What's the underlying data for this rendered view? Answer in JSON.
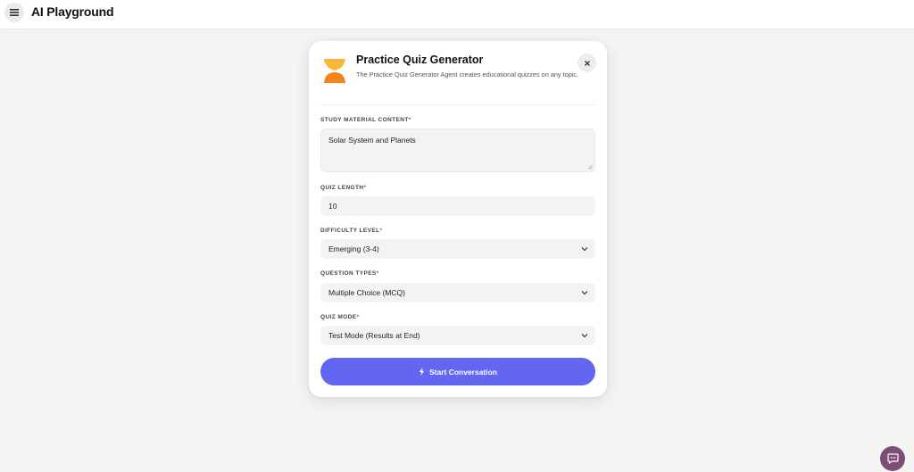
{
  "app": {
    "title": "AI Playground",
    "menu_icon": "hamburger-menu-icon"
  },
  "modal": {
    "title": "Practice Quiz Generator",
    "description": "The Practice Quiz Generator Agent creates educational quizzes on any topic.",
    "logo_icon": "quiz-generator-logo-icon",
    "close_icon": "close-icon",
    "fields": {
      "study_material": {
        "label": "STUDY MATERIAL CONTENT",
        "required_mark": "*",
        "value": "Solar System and Planets"
      },
      "quiz_length": {
        "label": "QUIZ LENGTH",
        "required_mark": "*",
        "value": "10"
      },
      "difficulty": {
        "label": "DIFFICULTY LEVEL",
        "required_mark": "*",
        "value": "Emerging (3-4)"
      },
      "question_types": {
        "label": "QUESTION TYPES",
        "required_mark": "*",
        "value": "Multiple Choice (MCQ)"
      },
      "quiz_mode": {
        "label": "QUIZ MODE",
        "required_mark": "*",
        "value": "Test Mode (Results at End)"
      }
    },
    "start_button": {
      "label": "Start Conversation",
      "icon": "lightning-bolt-icon"
    }
  },
  "chat_fab": {
    "icon": "chat-bubble-icon"
  },
  "colors": {
    "accent": "#6366f1",
    "logo_orange": "#f5841f",
    "logo_yellow": "#f8b63a",
    "required": "#d0463b",
    "chat_fab": "#7b4d77",
    "page_background": "#f5f4f2"
  }
}
